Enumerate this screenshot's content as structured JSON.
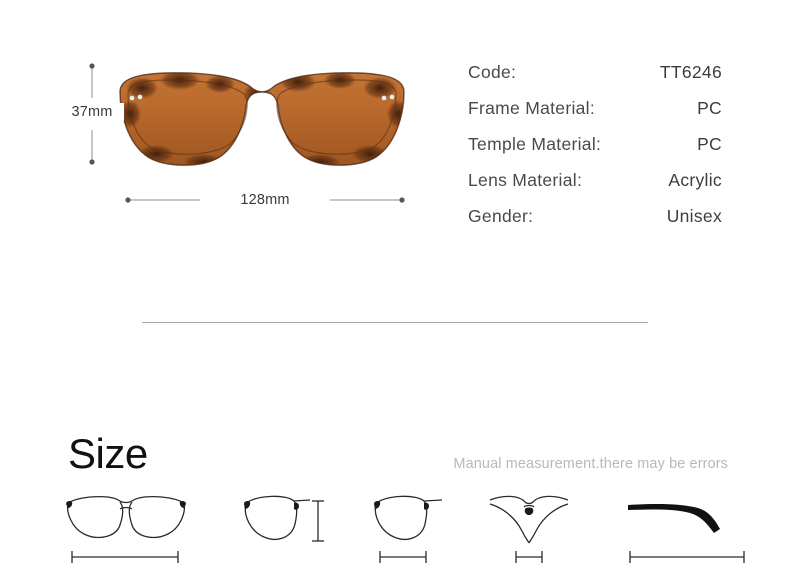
{
  "product": {
    "photo_alt": "tortoiseshell eyeglasses front view",
    "frame_colors": {
      "tortoise_light": "#d98b4a",
      "tortoise_mid": "#b06224",
      "tortoise_dark": "#4a2310",
      "temple": "#55585c",
      "rivet": "#e8e8e8",
      "lens": "#f7f9fa"
    }
  },
  "dimensions": {
    "height_label": "37mm",
    "width_label": "128mm"
  },
  "specs": {
    "rows": [
      {
        "label": "Code:",
        "value": "TT6246"
      },
      {
        "label": "Frame Material:",
        "value": "PC"
      },
      {
        "label": "Temple Material:",
        "value": "PC"
      },
      {
        "label": "Lens Material:",
        "value": "Acrylic"
      },
      {
        "label": "Gender:",
        "value": "Unisex"
      }
    ]
  },
  "size_section": {
    "heading": "Size",
    "note": "Manual measurement.there may be errors",
    "icons": [
      {
        "name": "frame-total-width",
        "measure": "horizontal"
      },
      {
        "name": "lens-height",
        "measure": "vertical"
      },
      {
        "name": "lens-width",
        "measure": "horizontal"
      },
      {
        "name": "bridge-width",
        "measure": "horizontal"
      },
      {
        "name": "temple-length",
        "measure": "horizontal"
      }
    ]
  },
  "colors": {
    "background": "#ffffff",
    "divider": "#a8a8a8",
    "text_dark": "#3d3d3d",
    "text_label": "#4a4a4a",
    "text_muted": "#b9b9b9",
    "heading": "#111111",
    "dimension_line": "#8c8c8c",
    "icon_stroke": "#2b2b2b"
  }
}
